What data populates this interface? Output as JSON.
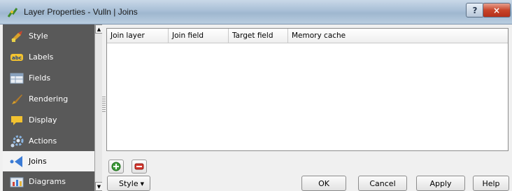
{
  "window": {
    "title": "Layer Properties - Vulln | Joins",
    "help_symbol": "?",
    "close_symbol": "×"
  },
  "sidebar": {
    "items": [
      {
        "label": "Style",
        "icon": "style-brush-icon"
      },
      {
        "label": "Labels",
        "icon": "labels-abc-icon"
      },
      {
        "label": "Fields",
        "icon": "fields-table-icon"
      },
      {
        "label": "Rendering",
        "icon": "rendering-brush-icon"
      },
      {
        "label": "Display",
        "icon": "display-speech-icon"
      },
      {
        "label": "Actions",
        "icon": "actions-gear-icon"
      },
      {
        "label": "Joins",
        "icon": "joins-arrow-icon",
        "active": true
      },
      {
        "label": "Diagrams",
        "icon": "diagrams-chart-icon"
      }
    ]
  },
  "joins_table": {
    "columns": [
      "Join layer",
      "Join field",
      "Target field",
      "Memory cache"
    ],
    "rows": []
  },
  "actions": {
    "add_join": "add-join-icon",
    "remove_join": "remove-join-icon"
  },
  "footer": {
    "style_label": "Style",
    "ok_label": "OK",
    "cancel_label": "Cancel",
    "apply_label": "Apply",
    "help_label": "Help"
  }
}
